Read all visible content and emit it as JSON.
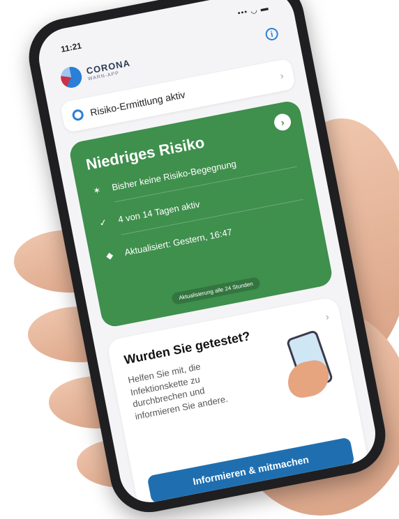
{
  "status_bar": {
    "time": "11:21",
    "indicators": "••• ◡ ▬"
  },
  "app": {
    "logo_title": "CORONA",
    "logo_subtitle": "WARN-APP",
    "info_icon": "info-icon"
  },
  "tracing": {
    "label": "Risiko-Ermittlung aktiv",
    "icon": "tracing-icon",
    "chevron": "›"
  },
  "risk_card": {
    "color": "#3f8f4d",
    "title": "Niedriges Risiko",
    "arrow": "›",
    "rows": [
      {
        "icon": "encounter-icon",
        "glyph": "✶",
        "text": "Bisher keine Risiko-Begegnung"
      },
      {
        "icon": "check-icon",
        "glyph": "✓",
        "text": "4 von 14 Tagen aktiv"
      },
      {
        "icon": "shield-icon",
        "glyph": "◆",
        "text": "Aktualisiert: Gestern, 16:47"
      }
    ],
    "note": "Aktualisierung alle 24 Stunden"
  },
  "test_card": {
    "title": "Wurden Sie getestet?",
    "body": "Helfen Sie mit, die Infektionskette zu durchbrechen und informieren Sie andere.",
    "chevron": "›",
    "button_label": "Informieren & mitmachen",
    "button_color": "#1f6fb0"
  }
}
